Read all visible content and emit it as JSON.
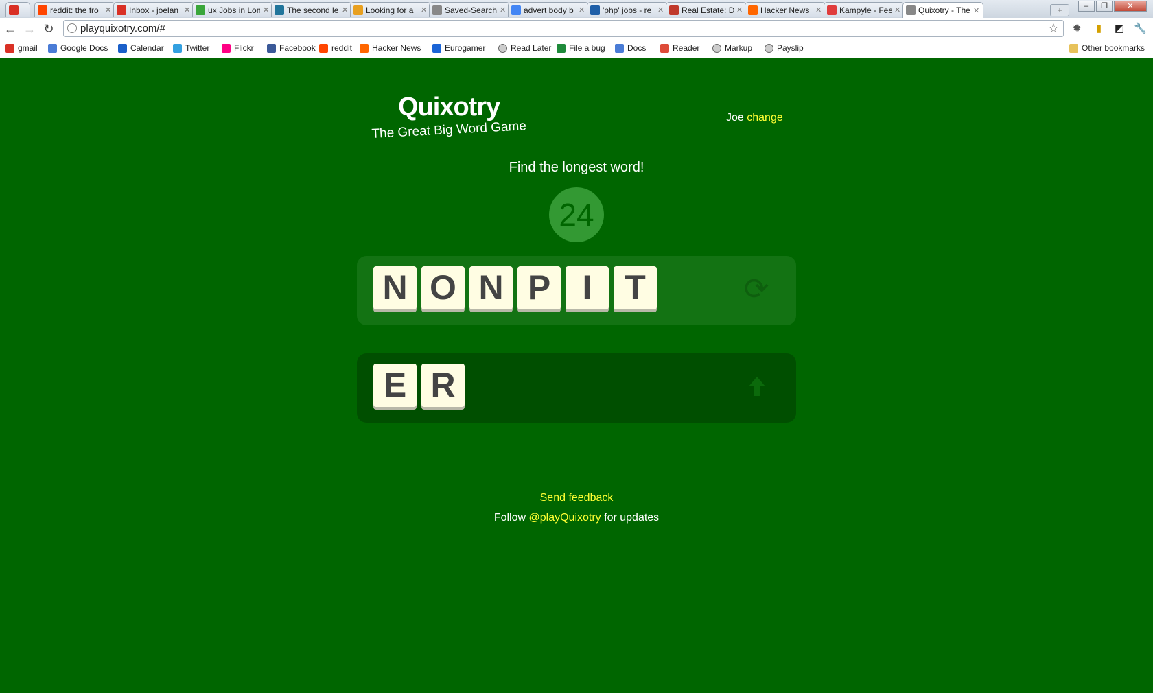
{
  "browser": {
    "tabs": [
      {
        "title": "gmail",
        "icon": "gmail-icon",
        "color": "#d93025"
      },
      {
        "title": "reddit: the fro",
        "icon": "reddit-icon",
        "color": "#ff4500"
      },
      {
        "title": "Inbox - joelan",
        "icon": "gmail-icon",
        "color": "#d93025"
      },
      {
        "title": "ux Jobs in Lon",
        "icon": "search-icon",
        "color": "#3aa63a"
      },
      {
        "title": "The second le",
        "icon": "wordpress-icon",
        "color": "#21759b"
      },
      {
        "title": "Looking for a",
        "icon": "page-icon",
        "color": "#e8a020"
      },
      {
        "title": "Saved-Search",
        "icon": "globe-icon",
        "color": "#888888"
      },
      {
        "title": "advert body b",
        "icon": "google-icon",
        "color": "#4285f4"
      },
      {
        "title": "'php' jobs - re",
        "icon": "page-icon",
        "color": "#1f5fa8"
      },
      {
        "title": "Real Estate: D",
        "icon": "blocked-icon",
        "color": "#c0392b"
      },
      {
        "title": "Hacker News",
        "icon": "hackernews-icon",
        "color": "#ff6600"
      },
      {
        "title": "Kampyle - Fee",
        "icon": "kampyle-icon",
        "color": "#e03c3c"
      },
      {
        "title": "Quixotry - The",
        "icon": "globe-icon",
        "color": "#888888"
      }
    ],
    "url": "playquixotry.com/#",
    "bookmarks": [
      {
        "label": "gmail",
        "icon": "gmail-icon",
        "color": "#d93025"
      },
      {
        "label": "Google Docs",
        "icon": "docs-icon",
        "color": "#4a7cd6"
      },
      {
        "label": "Calendar",
        "icon": "calendar-icon",
        "color": "#1a5fc9"
      },
      {
        "label": "Twitter",
        "icon": "twitter-icon",
        "color": "#33a0e0"
      },
      {
        "label": "Flickr",
        "icon": "flickr-icon",
        "color": "#ff0084"
      },
      {
        "label": "Facebook",
        "icon": "facebook-icon",
        "color": "#3b5998"
      },
      {
        "label": "reddit",
        "icon": "reddit-icon",
        "color": "#ff4500"
      },
      {
        "label": "Hacker News",
        "icon": "hackernews-icon",
        "color": "#ff6600"
      },
      {
        "label": "Eurogamer",
        "icon": "eurogamer-icon",
        "color": "#1a64d6"
      },
      {
        "label": "Read Later",
        "icon": "globe-icon",
        "color": "#888888"
      },
      {
        "label": "File a bug",
        "icon": "bug-icon",
        "color": "#1e8a3a"
      },
      {
        "label": "Docs",
        "icon": "docs-icon",
        "color": "#4a7cd6"
      },
      {
        "label": "Reader",
        "icon": "reader-icon",
        "color": "#dd4b39"
      },
      {
        "label": "Markup",
        "icon": "globe-icon",
        "color": "#888888"
      },
      {
        "label": "Payslip",
        "icon": "globe-icon",
        "color": "#888888"
      }
    ],
    "other_bookmarks": "Other bookmarks"
  },
  "game": {
    "title": "Quixotry",
    "subtitle": "The Great Big Word Game",
    "user_name": "Joe",
    "change_label": "change",
    "instruction": "Find the longest word!",
    "timer": "24",
    "available_letters": [
      "N",
      "O",
      "N",
      "P",
      "I",
      "T"
    ],
    "current_word": [
      "E",
      "R"
    ],
    "feedback_label": "Send feedback",
    "follow_prefix": "Follow",
    "follow_handle": "@playQuixotry",
    "follow_suffix": "for updates",
    "colors": {
      "background": "#006600",
      "timer_circle": "#339933",
      "letters_panel": "#137313",
      "word_panel": "#004f00",
      "tile": "#fffde3",
      "link": "#ffff33"
    }
  }
}
